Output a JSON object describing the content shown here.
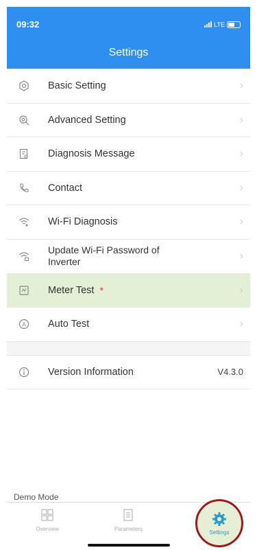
{
  "status_bar": {
    "time": "09:32",
    "network": "LTE"
  },
  "header": {
    "title": "Settings"
  },
  "menu": [
    {
      "label": "Basic Setting",
      "icon": "gear-hex-icon"
    },
    {
      "label": "Advanced Setting",
      "icon": "gear-search-icon"
    },
    {
      "label": "Diagnosis Message",
      "icon": "document-icon"
    },
    {
      "label": "Contact",
      "icon": "phone-icon"
    },
    {
      "label": "Wi-Fi Diagnosis",
      "icon": "wifi-icon"
    },
    {
      "label": "Update Wi-Fi Password of Inverter",
      "icon": "wifi-lock-icon"
    },
    {
      "label": "Meter Test",
      "icon": "meter-icon",
      "badge": "*"
    },
    {
      "label": "Auto Test",
      "icon": "auto-icon"
    }
  ],
  "version": {
    "label": "Version Information",
    "value": "V4.3.0"
  },
  "demo_mode": "Demo Mode",
  "tabs": [
    {
      "label": "Overview"
    },
    {
      "label": "Parameters"
    },
    {
      "label": "Settings"
    }
  ],
  "colors": {
    "accent": "#2f8ff0",
    "highlight": "#e3f0d6",
    "ring": "#9b1c1c"
  }
}
